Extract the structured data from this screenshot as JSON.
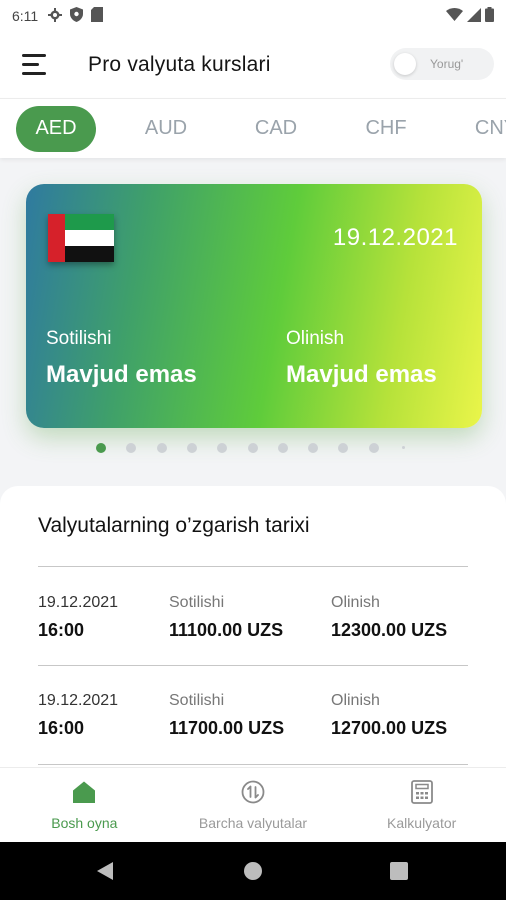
{
  "status_bar": {
    "time": "6:11"
  },
  "app_bar": {
    "title": "Pro valyuta kurslari",
    "theme_toggle_label": "Yorug'"
  },
  "tabs": [
    {
      "label": "AED",
      "active": true
    },
    {
      "label": "AUD",
      "active": false
    },
    {
      "label": "CAD",
      "active": false
    },
    {
      "label": "CHF",
      "active": false
    },
    {
      "label": "CNY",
      "active": false
    }
  ],
  "card": {
    "flag": "uae-flag",
    "date": "19.12.2021",
    "sell_label": "Sotilishi",
    "sell_value": "Mavjud emas",
    "buy_label": "Olinish",
    "buy_value": "Mavjud emas"
  },
  "pager": {
    "count": 11,
    "active_index": 0
  },
  "history": {
    "title": "Valyutalarning o’zgarish tarixi",
    "rows": [
      {
        "date": "19.12.2021",
        "time": "16:00",
        "sell_label": "Sotilishi",
        "sell_value": "11100.00 UZS",
        "buy_label": "Olinish",
        "buy_value": "12300.00 UZS"
      },
      {
        "date": "19.12.2021",
        "time": "16:00",
        "sell_label": "Sotilishi",
        "sell_value": "11700.00 UZS",
        "buy_label": "Olinish",
        "buy_value": "12700.00 UZS"
      }
    ]
  },
  "bottom_nav": [
    {
      "label": "Bosh oyna",
      "icon": "home-icon",
      "active": true
    },
    {
      "label": "Barcha valyutalar",
      "icon": "currency-exchange-icon",
      "active": false
    },
    {
      "label": "Kalkulyator",
      "icon": "calculator-icon",
      "active": false
    }
  ],
  "colors": {
    "accent": "#4a9a4e",
    "inactive": "#9aa3ab"
  }
}
